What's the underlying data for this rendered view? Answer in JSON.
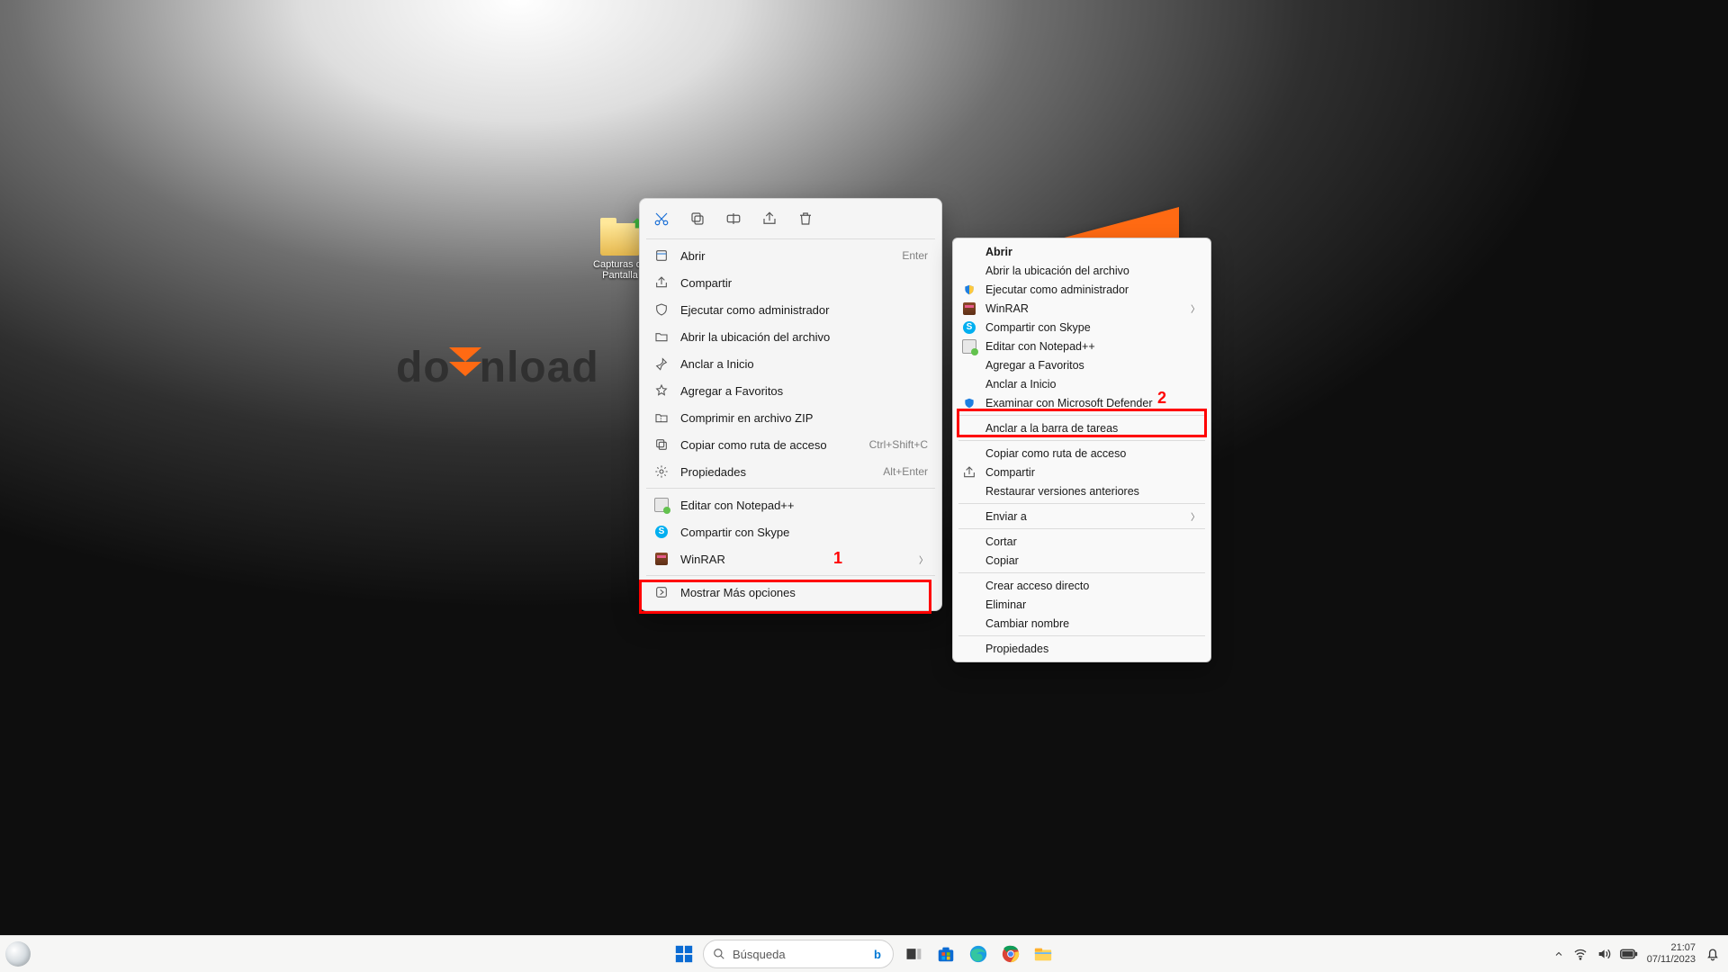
{
  "desktop": {
    "icon_label": "Capturas de Pantalla",
    "wallpaper_word_left": "do",
    "wallpaper_word_right": "nload"
  },
  "callouts": {
    "one": "1",
    "two": "2"
  },
  "modern_menu": {
    "toolbar": [
      "cut",
      "copy",
      "rename",
      "share",
      "delete"
    ],
    "items": [
      {
        "icon": "open",
        "label": "Abrir",
        "shortcut": "Enter"
      },
      {
        "icon": "share",
        "label": "Compartir"
      },
      {
        "icon": "admin",
        "label": "Ejecutar como administrador"
      },
      {
        "icon": "folder",
        "label": "Abrir la ubicación del archivo"
      },
      {
        "icon": "pin",
        "label": "Anclar a Inicio"
      },
      {
        "icon": "star",
        "label": "Agregar a Favoritos"
      },
      {
        "icon": "zip",
        "label": "Comprimir en archivo ZIP"
      },
      {
        "icon": "path",
        "label": "Copiar como ruta de acceso",
        "shortcut": "Ctrl+Shift+C"
      },
      {
        "icon": "props",
        "label": "Propiedades",
        "shortcut": "Alt+Enter"
      }
    ],
    "apps": [
      {
        "icon": "npp",
        "label": "Editar con Notepad++"
      },
      {
        "icon": "skype",
        "label": "Compartir con Skype"
      },
      {
        "icon": "winrar",
        "label": "WinRAR",
        "submenu": true
      }
    ],
    "more": {
      "label": "Mostrar Más opciones"
    }
  },
  "classic_menu": {
    "sections": [
      [
        {
          "label": "Abrir",
          "bold": true
        },
        {
          "label": "Abrir la ubicación del archivo"
        },
        {
          "label": "Ejecutar como administrador",
          "icon": "shield"
        },
        {
          "label": "WinRAR",
          "icon": "winrar",
          "submenu": true
        },
        {
          "label": "Compartir con Skype",
          "icon": "skype"
        },
        {
          "label": "Editar con Notepad++",
          "icon": "npp"
        },
        {
          "label": "Agregar a Favoritos"
        },
        {
          "label": "Anclar a Inicio"
        },
        {
          "label": "Examinar con Microsoft Defender",
          "icon": "defender"
        }
      ],
      [
        {
          "label": "Anclar a la barra de tareas"
        }
      ],
      [
        {
          "label": "Copiar como ruta de acceso"
        },
        {
          "label": "Compartir",
          "icon": "share"
        },
        {
          "label": "Restaurar versiones anteriores"
        }
      ],
      [
        {
          "label": "Enviar a",
          "submenu": true
        }
      ],
      [
        {
          "label": "Cortar"
        },
        {
          "label": "Copiar"
        }
      ],
      [
        {
          "label": "Crear acceso directo"
        },
        {
          "label": "Eliminar"
        },
        {
          "label": "Cambiar nombre"
        }
      ],
      [
        {
          "label": "Propiedades"
        }
      ]
    ]
  },
  "taskbar": {
    "search_placeholder": "Búsqueda",
    "time": "21:07",
    "date": "07/11/2023"
  }
}
